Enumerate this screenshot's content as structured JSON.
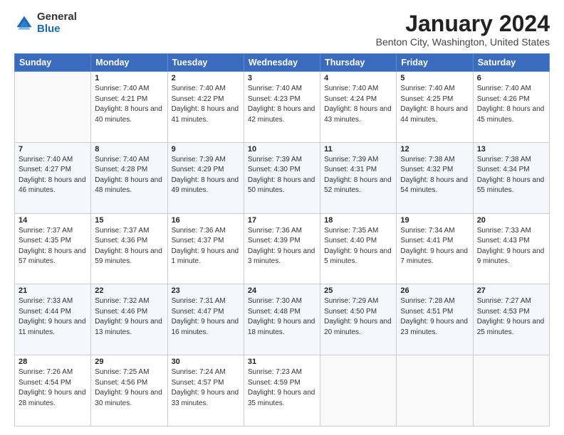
{
  "logo": {
    "general": "General",
    "blue": "Blue"
  },
  "header": {
    "month": "January 2024",
    "location": "Benton City, Washington, United States"
  },
  "weekdays": [
    "Sunday",
    "Monday",
    "Tuesday",
    "Wednesday",
    "Thursday",
    "Friday",
    "Saturday"
  ],
  "weeks": [
    [
      {
        "day": "",
        "sunrise": "",
        "sunset": "",
        "daylight": ""
      },
      {
        "day": "1",
        "sunrise": "Sunrise: 7:40 AM",
        "sunset": "Sunset: 4:21 PM",
        "daylight": "Daylight: 8 hours and 40 minutes."
      },
      {
        "day": "2",
        "sunrise": "Sunrise: 7:40 AM",
        "sunset": "Sunset: 4:22 PM",
        "daylight": "Daylight: 8 hours and 41 minutes."
      },
      {
        "day": "3",
        "sunrise": "Sunrise: 7:40 AM",
        "sunset": "Sunset: 4:23 PM",
        "daylight": "Daylight: 8 hours and 42 minutes."
      },
      {
        "day": "4",
        "sunrise": "Sunrise: 7:40 AM",
        "sunset": "Sunset: 4:24 PM",
        "daylight": "Daylight: 8 hours and 43 minutes."
      },
      {
        "day": "5",
        "sunrise": "Sunrise: 7:40 AM",
        "sunset": "Sunset: 4:25 PM",
        "daylight": "Daylight: 8 hours and 44 minutes."
      },
      {
        "day": "6",
        "sunrise": "Sunrise: 7:40 AM",
        "sunset": "Sunset: 4:26 PM",
        "daylight": "Daylight: 8 hours and 45 minutes."
      }
    ],
    [
      {
        "day": "7",
        "sunrise": "Sunrise: 7:40 AM",
        "sunset": "Sunset: 4:27 PM",
        "daylight": "Daylight: 8 hours and 46 minutes."
      },
      {
        "day": "8",
        "sunrise": "Sunrise: 7:40 AM",
        "sunset": "Sunset: 4:28 PM",
        "daylight": "Daylight: 8 hours and 48 minutes."
      },
      {
        "day": "9",
        "sunrise": "Sunrise: 7:39 AM",
        "sunset": "Sunset: 4:29 PM",
        "daylight": "Daylight: 8 hours and 49 minutes."
      },
      {
        "day": "10",
        "sunrise": "Sunrise: 7:39 AM",
        "sunset": "Sunset: 4:30 PM",
        "daylight": "Daylight: 8 hours and 50 minutes."
      },
      {
        "day": "11",
        "sunrise": "Sunrise: 7:39 AM",
        "sunset": "Sunset: 4:31 PM",
        "daylight": "Daylight: 8 hours and 52 minutes."
      },
      {
        "day": "12",
        "sunrise": "Sunrise: 7:38 AM",
        "sunset": "Sunset: 4:32 PM",
        "daylight": "Daylight: 8 hours and 54 minutes."
      },
      {
        "day": "13",
        "sunrise": "Sunrise: 7:38 AM",
        "sunset": "Sunset: 4:34 PM",
        "daylight": "Daylight: 8 hours and 55 minutes."
      }
    ],
    [
      {
        "day": "14",
        "sunrise": "Sunrise: 7:37 AM",
        "sunset": "Sunset: 4:35 PM",
        "daylight": "Daylight: 8 hours and 57 minutes."
      },
      {
        "day": "15",
        "sunrise": "Sunrise: 7:37 AM",
        "sunset": "Sunset: 4:36 PM",
        "daylight": "Daylight: 8 hours and 59 minutes."
      },
      {
        "day": "16",
        "sunrise": "Sunrise: 7:36 AM",
        "sunset": "Sunset: 4:37 PM",
        "daylight": "Daylight: 9 hours and 1 minute."
      },
      {
        "day": "17",
        "sunrise": "Sunrise: 7:36 AM",
        "sunset": "Sunset: 4:39 PM",
        "daylight": "Daylight: 9 hours and 3 minutes."
      },
      {
        "day": "18",
        "sunrise": "Sunrise: 7:35 AM",
        "sunset": "Sunset: 4:40 PM",
        "daylight": "Daylight: 9 hours and 5 minutes."
      },
      {
        "day": "19",
        "sunrise": "Sunrise: 7:34 AM",
        "sunset": "Sunset: 4:41 PM",
        "daylight": "Daylight: 9 hours and 7 minutes."
      },
      {
        "day": "20",
        "sunrise": "Sunrise: 7:33 AM",
        "sunset": "Sunset: 4:43 PM",
        "daylight": "Daylight: 9 hours and 9 minutes."
      }
    ],
    [
      {
        "day": "21",
        "sunrise": "Sunrise: 7:33 AM",
        "sunset": "Sunset: 4:44 PM",
        "daylight": "Daylight: 9 hours and 11 minutes."
      },
      {
        "day": "22",
        "sunrise": "Sunrise: 7:32 AM",
        "sunset": "Sunset: 4:46 PM",
        "daylight": "Daylight: 9 hours and 13 minutes."
      },
      {
        "day": "23",
        "sunrise": "Sunrise: 7:31 AM",
        "sunset": "Sunset: 4:47 PM",
        "daylight": "Daylight: 9 hours and 16 minutes."
      },
      {
        "day": "24",
        "sunrise": "Sunrise: 7:30 AM",
        "sunset": "Sunset: 4:48 PM",
        "daylight": "Daylight: 9 hours and 18 minutes."
      },
      {
        "day": "25",
        "sunrise": "Sunrise: 7:29 AM",
        "sunset": "Sunset: 4:50 PM",
        "daylight": "Daylight: 9 hours and 20 minutes."
      },
      {
        "day": "26",
        "sunrise": "Sunrise: 7:28 AM",
        "sunset": "Sunset: 4:51 PM",
        "daylight": "Daylight: 9 hours and 23 minutes."
      },
      {
        "day": "27",
        "sunrise": "Sunrise: 7:27 AM",
        "sunset": "Sunset: 4:53 PM",
        "daylight": "Daylight: 9 hours and 25 minutes."
      }
    ],
    [
      {
        "day": "28",
        "sunrise": "Sunrise: 7:26 AM",
        "sunset": "Sunset: 4:54 PM",
        "daylight": "Daylight: 9 hours and 28 minutes."
      },
      {
        "day": "29",
        "sunrise": "Sunrise: 7:25 AM",
        "sunset": "Sunset: 4:56 PM",
        "daylight": "Daylight: 9 hours and 30 minutes."
      },
      {
        "day": "30",
        "sunrise": "Sunrise: 7:24 AM",
        "sunset": "Sunset: 4:57 PM",
        "daylight": "Daylight: 9 hours and 33 minutes."
      },
      {
        "day": "31",
        "sunrise": "Sunrise: 7:23 AM",
        "sunset": "Sunset: 4:59 PM",
        "daylight": "Daylight: 9 hours and 35 minutes."
      },
      {
        "day": "",
        "sunrise": "",
        "sunset": "",
        "daylight": ""
      },
      {
        "day": "",
        "sunrise": "",
        "sunset": "",
        "daylight": ""
      },
      {
        "day": "",
        "sunrise": "",
        "sunset": "",
        "daylight": ""
      }
    ]
  ]
}
